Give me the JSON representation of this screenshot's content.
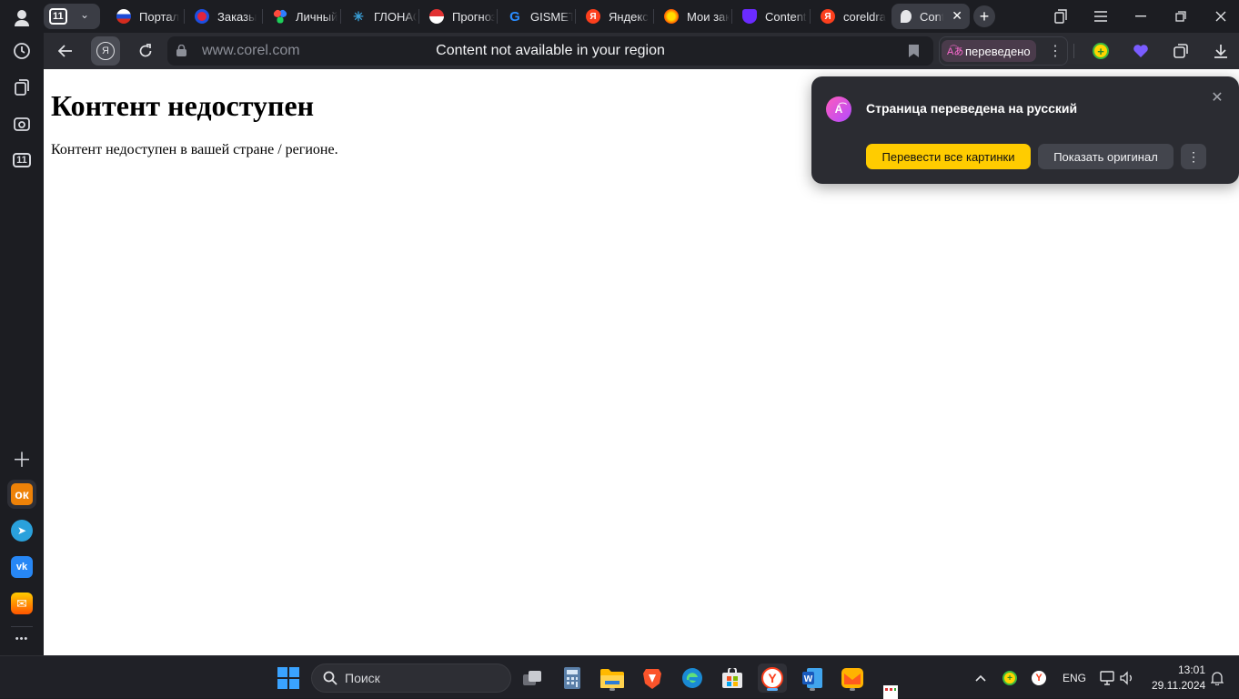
{
  "sidebar": {
    "top_badge": "11",
    "bottom_more": "•••"
  },
  "tabs": {
    "group_badge": "11",
    "items": [
      {
        "title": "Портал",
        "fav_color": "#ffffff"
      },
      {
        "title": "Заказы",
        "fav_color": "#e1243c"
      },
      {
        "title": "Личный",
        "fav_color": "#2f7dff"
      },
      {
        "title": "ГЛОНАСС",
        "fav_color": "#3aa0d8"
      },
      {
        "title": "Прогноз",
        "fav_color": "#e13232"
      },
      {
        "title": "GISMETEO",
        "fav_color": "#2a8cff",
        "fav_letter": "G"
      },
      {
        "title": "Яндекс",
        "fav_color": "#fc3f1d",
        "fav_letter": "Я"
      },
      {
        "title": "Мои заказы",
        "fav_color": "#ff9900"
      },
      {
        "title": "Content",
        "fav_color": "#6b2bff"
      },
      {
        "title": "coreldraw",
        "fav_color": "#fc3f1d",
        "fav_letter": "Я"
      },
      {
        "title": "Content",
        "fav_color": "#e6e7ea",
        "active": true
      }
    ]
  },
  "toolbar": {
    "url": "www.corel.com",
    "title": "Content not available in your region",
    "translated_label": "переведено",
    "yandex_button": "Я"
  },
  "page": {
    "heading": "Контент недоступен",
    "body": "Контент недоступен в вашей стране / регионе."
  },
  "popup": {
    "title": "Страница переведена на русский",
    "translate_images": "Перевести все картинки",
    "show_original": "Показать оригинал"
  },
  "taskbar": {
    "search_placeholder": "Поиск",
    "lang": "ENG",
    "time": "13:01",
    "date": "29.11.2024"
  }
}
